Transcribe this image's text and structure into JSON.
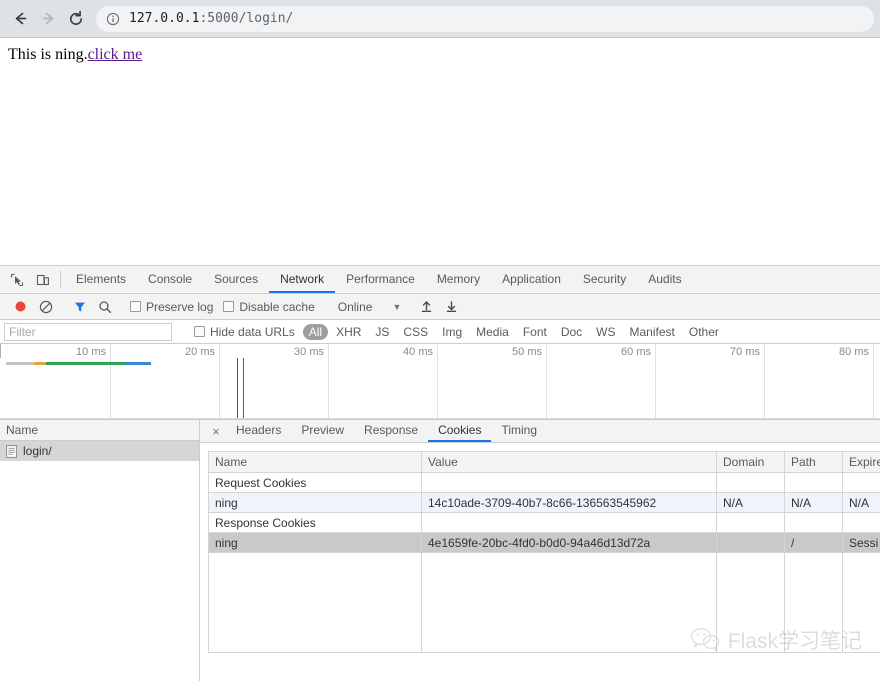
{
  "browser": {
    "back_label": "Back",
    "forward_label": "Forward",
    "reload_label": "Reload",
    "url_host": "127.0.0.1",
    "url_path": ":5000/login/",
    "url_full": "127.0.0.1:5000/login/"
  },
  "page": {
    "text": "This is ning.",
    "link_label": "click me"
  },
  "devtools": {
    "tabs": [
      {
        "label": "Elements",
        "active": false
      },
      {
        "label": "Console",
        "active": false
      },
      {
        "label": "Sources",
        "active": false
      },
      {
        "label": "Network",
        "active": true
      },
      {
        "label": "Performance",
        "active": false
      },
      {
        "label": "Memory",
        "active": false
      },
      {
        "label": "Application",
        "active": false
      },
      {
        "label": "Security",
        "active": false
      },
      {
        "label": "Audits",
        "active": false
      }
    ],
    "toolbar": {
      "preserve_log_label": "Preserve log",
      "preserve_log_checked": false,
      "disable_cache_label": "Disable cache",
      "disable_cache_checked": false,
      "throttle_value": "Online",
      "caret": "▼"
    },
    "filter": {
      "placeholder": "Filter",
      "value": "",
      "hide_data_urls_label": "Hide data URLs",
      "hide_data_urls_checked": false,
      "types": [
        {
          "label": "All",
          "active": true
        },
        {
          "label": "XHR",
          "active": false
        },
        {
          "label": "JS",
          "active": false
        },
        {
          "label": "CSS",
          "active": false
        },
        {
          "label": "Img",
          "active": false
        },
        {
          "label": "Media",
          "active": false
        },
        {
          "label": "Font",
          "active": false
        },
        {
          "label": "Doc",
          "active": false
        },
        {
          "label": "WS",
          "active": false
        },
        {
          "label": "Manifest",
          "active": false
        },
        {
          "label": "Other",
          "active": false
        }
      ]
    },
    "overview": {
      "ticks": [
        "10 ms",
        "20 ms",
        "30 ms",
        "40 ms",
        "50 ms",
        "60 ms",
        "70 ms",
        "80 ms"
      ],
      "request_bands": [
        {
          "color": "#c4c4c4",
          "left_pct": 0.7,
          "width_pct": 3.2
        },
        {
          "color": "#e8a33d",
          "left_pct": 3.9,
          "width_pct": 1.3
        },
        {
          "color": "#31a354",
          "left_pct": 5.2,
          "width_pct": 9.1
        },
        {
          "color": "#3b89d6",
          "left_pct": 14.3,
          "width_pct": 2.8
        }
      ],
      "event_lines": [
        {
          "color": "#b03030",
          "left_pct": 26.9
        },
        {
          "color": "#2b6cb0",
          "left_pct": 27.6
        }
      ]
    },
    "requests": {
      "column_header": "Name",
      "rows": [
        {
          "name": "login/",
          "selected": true
        }
      ]
    },
    "detail": {
      "close_label": "×",
      "tabs": [
        {
          "label": "Headers",
          "active": false
        },
        {
          "label": "Preview",
          "active": false
        },
        {
          "label": "Response",
          "active": false
        },
        {
          "label": "Cookies",
          "active": true
        },
        {
          "label": "Timing",
          "active": false
        }
      ],
      "cookies": {
        "columns": [
          "Name",
          "Value",
          "Domain",
          "Path",
          "Expire"
        ],
        "rows": [
          {
            "type": "group",
            "label": "Request Cookies",
            "cells": [
              "Request Cookies",
              "",
              "",
              "",
              ""
            ]
          },
          {
            "type": "request",
            "cells": [
              "ning",
              "14c10ade-3709-40b7-8c66-136563545962",
              "N/A",
              "N/A",
              "N/A"
            ]
          },
          {
            "type": "group",
            "label": "Response Cookies",
            "cells": [
              "Response Cookies",
              "",
              "",
              "",
              ""
            ]
          },
          {
            "type": "response",
            "cells": [
              "ning",
              "4e1659fe-20bc-4fd0-b0d0-94a46d13d72a",
              "",
              "/",
              "Sessi"
            ]
          }
        ]
      }
    }
  },
  "watermark": {
    "text": "Flask学习笔记"
  },
  "colors": {
    "accent": "#1a73e8",
    "record": "#e8453c",
    "filter_active": "#1a73e8",
    "chrome_bg": "#dee1e6",
    "panel_bg": "#f3f3f3",
    "row_selected": "#c9c9c9",
    "row_request": "#eff3fb",
    "link": "#551a8b"
  }
}
